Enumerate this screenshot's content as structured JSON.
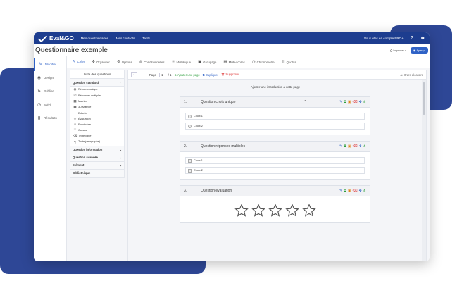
{
  "app": {
    "brand": "Eval&GO",
    "top_nav": [
      "Mes questionnaires",
      "Mes contacts",
      "Tarifs"
    ],
    "account_text": "Vous êtes en compte PRO+",
    "help_icon": "question-circle-icon",
    "user_icon": "user-icon"
  },
  "title_bar": {
    "title": "Questionnaire exemple",
    "print_label": "Imprimer",
    "preview_label": "Aperçu"
  },
  "left_nav": [
    {
      "label": "Modifier",
      "icon": "pencil-icon",
      "active": true
    },
    {
      "label": "Design",
      "icon": "palette-icon",
      "active": false
    },
    {
      "label": "Publier",
      "icon": "send-icon",
      "active": false
    },
    {
      "label": "Suivi",
      "icon": "clock-icon",
      "active": false
    },
    {
      "label": "Résultats",
      "icon": "bar-chart-icon",
      "active": false
    }
  ],
  "tabs": [
    {
      "label": "Créer",
      "icon": "pencil-icon",
      "active": true
    },
    {
      "label": "Organiser",
      "icon": "move-icon",
      "active": false
    },
    {
      "label": "Options",
      "icon": "gear-icon",
      "active": false
    },
    {
      "label": "Conditionnelles",
      "icon": "branch-icon",
      "active": false
    },
    {
      "label": "Multilingue",
      "icon": "translate-icon",
      "active": false
    },
    {
      "label": "Groupage",
      "icon": "group-icon",
      "active": false
    },
    {
      "label": "Multi-scores",
      "icon": "scores-icon",
      "active": false
    },
    {
      "label": "Chronomètre",
      "icon": "stopwatch-icon",
      "active": false
    },
    {
      "label": "Quotas",
      "icon": "quota-icon",
      "active": false
    }
  ],
  "question_panel": {
    "title": "Liste des questions",
    "sections": [
      {
        "label": "Question standard",
        "expanded": true,
        "items": [
          {
            "label": "Réponse unique",
            "icon": "radio-icon"
          },
          {
            "label": "Réponses multiples",
            "icon": "checkbox-icon"
          },
          {
            "label": "Matrice",
            "icon": "grid-icon"
          },
          {
            "label": "3D Matrice",
            "icon": "grid-3d-icon"
          },
          {
            "label": "Echelle",
            "icon": "scale-icon"
          },
          {
            "label": "Évaluation",
            "icon": "star-icon"
          },
          {
            "label": "Emoticône",
            "icon": "smiley-icon"
          },
          {
            "label": "Curseur",
            "icon": "slider-icon"
          },
          {
            "label": "Texte(ligne)",
            "icon": "text-line-icon"
          },
          {
            "label": "Texte(paragraphe)",
            "icon": "text-paragraph-icon"
          }
        ]
      },
      {
        "label": "Question information",
        "expanded": false,
        "items": []
      },
      {
        "label": "Question avancée",
        "expanded": false,
        "items": []
      },
      {
        "label": "Elément",
        "expanded": false,
        "items": []
      },
      {
        "label": "Bibliothèque",
        "expanded": false,
        "items": []
      }
    ]
  },
  "toolbar": {
    "page_label": "Page",
    "page_value": "1",
    "page_total": "/ 1",
    "add_page": "Ajouter une page",
    "duplicate": "Dupliquer",
    "delete": "Supprimer",
    "random_order": "Ordre aléatoire"
  },
  "editor": {
    "intro_link": "Ajouter une introduction à cette page",
    "questions": [
      {
        "number": "1.",
        "title": "Question choix unique",
        "required_mark": "*",
        "type": "radio",
        "choices": [
          "Choix 1",
          "Choix 2"
        ]
      },
      {
        "number": "2.",
        "title": "Question réponses multiples",
        "required_mark": "",
        "type": "checkbox",
        "choices": [
          "Choix 1",
          "Choix 2"
        ]
      },
      {
        "number": "3.",
        "title": "Question évaluation",
        "required_mark": "",
        "type": "stars",
        "star_count": 5
      }
    ]
  },
  "colors": {
    "topbar": "#1d3d8f",
    "accent": "#2f62c6",
    "decor_blue": "#2e4796",
    "green": "#2a9d3a",
    "red": "#dd3333"
  }
}
